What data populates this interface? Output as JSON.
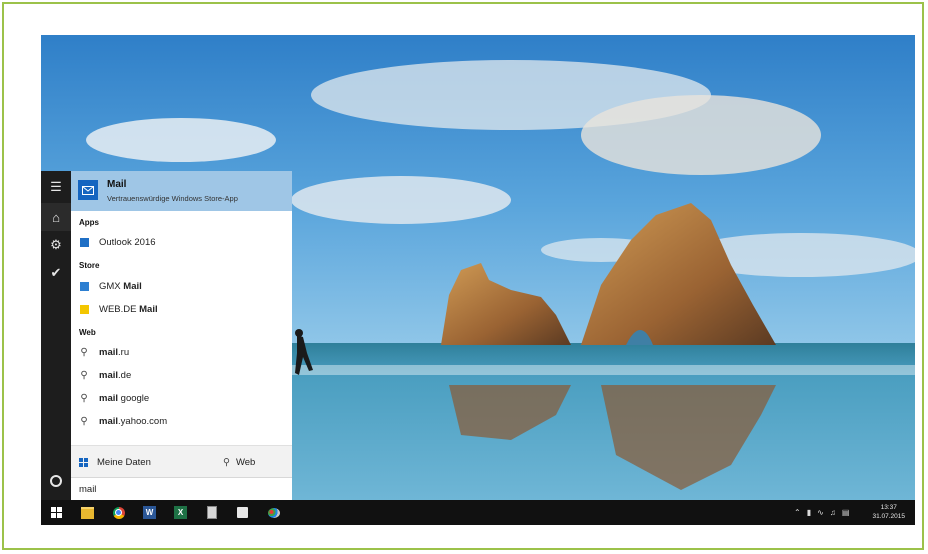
{
  "search": {
    "best_match": {
      "title": "Mail",
      "subtitle": "Vertrauenswürdige Windows Store-App"
    },
    "sections": {
      "apps": "Apps",
      "store": "Store",
      "web": "Web"
    },
    "apps": [
      {
        "label": "Outlook 2016",
        "icon": "outlook-icon"
      }
    ],
    "store": [
      {
        "prefix": "GMX ",
        "bold": "Mail",
        "icon": "gmx-app-icon"
      },
      {
        "prefix": "WEB.DE ",
        "bold": "Mail",
        "icon": "webde-app-icon"
      }
    ],
    "web": [
      {
        "bold": "mail",
        "suffix": ".ru"
      },
      {
        "bold": "mail",
        "suffix": ".de"
      },
      {
        "bold": "mail",
        "suffix": " google"
      },
      {
        "bold": "mail",
        "suffix": ".yahoo.com"
      }
    ],
    "bottom": {
      "my_data": "Meine Daten",
      "web": "Web"
    },
    "query": "mail"
  },
  "taskbar": {
    "time": "13:37",
    "date": "31.07.2015",
    "icons": [
      "windows-start-icon",
      "file-explorer-icon",
      "chrome-icon",
      "word-icon",
      "excel-icon",
      "calculator-icon",
      "store-icon",
      "paint-icon"
    ]
  },
  "colors": {
    "accent": "#1565c0",
    "best_match_bg": "#9fc6e6",
    "frame": "#9cc24a"
  }
}
